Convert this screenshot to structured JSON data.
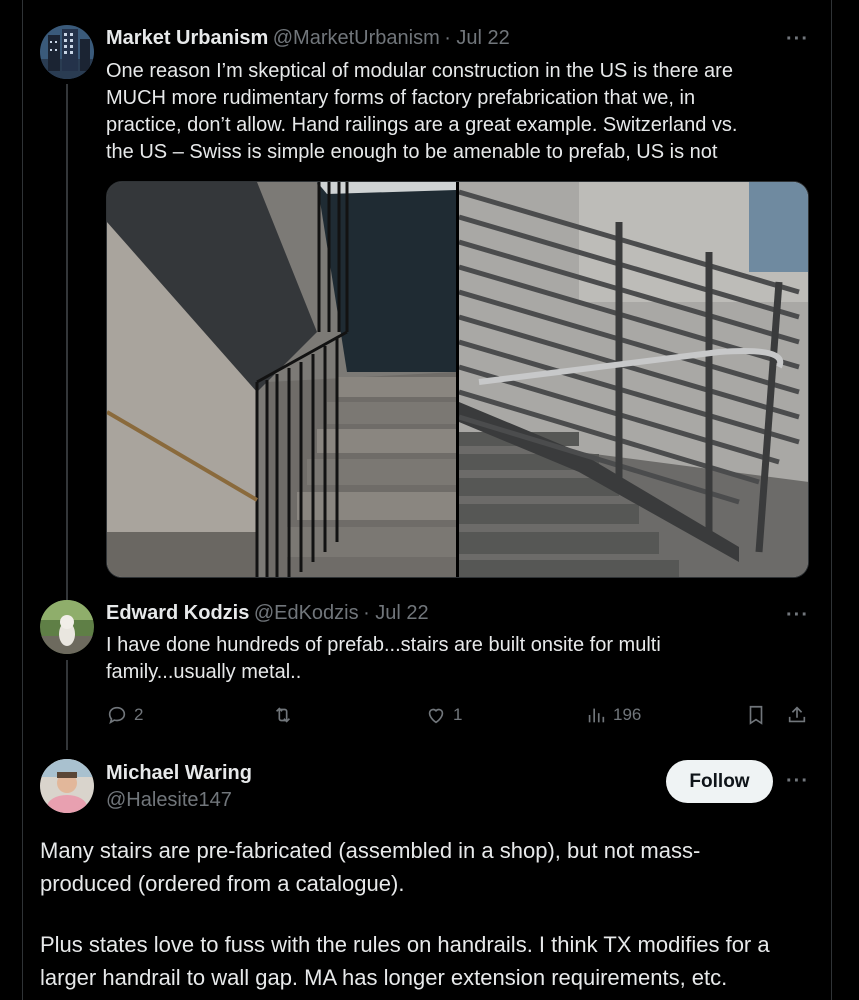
{
  "tweets": [
    {
      "name": "Market Urbanism",
      "handle": "@MarketUrbanism",
      "date": "· Jul 22",
      "text_lines": [
        "One reason I’m skeptical of modular construction in the US is there are",
        "MUCH more rudimentary forms of factory prefabrication that we, in",
        "practice, don’t allow. Hand railings are a great example. Switzerland vs.",
        "the US – Swiss is simple enough to be amenable to prefab, US is not"
      ],
      "media_description_icon": "photo-icon"
    },
    {
      "name": "Edward Kodzis",
      "handle": "@EdKodzis",
      "date": "· Jul 22",
      "text_lines": [
        "I have done hundreds of prefab...stairs are  built onsite for multi",
        "family...usually metal.."
      ],
      "actions": {
        "replies": "2",
        "retweets": "",
        "likes": "1",
        "views": "196"
      }
    },
    {
      "name": "Michael Waring",
      "handle": "@Halesite147",
      "follow_label": "Follow",
      "paragraph1_lines": [
        "Many stairs are pre-fabricated (assembled in a shop), but not mass-",
        "produced (ordered from a catalogue)."
      ],
      "paragraph2_lines": [
        "Plus states love to fuss with the rules on handrails. I think TX modifies for a",
        "larger handrail to wall gap. MA has longer extension requirements, etc."
      ]
    }
  ],
  "more_label": "···",
  "colors": {
    "background": "#000000",
    "text": "#e7e9ea",
    "secondary": "#71767b",
    "border": "#2f3336",
    "follow_bg": "#eff3f4"
  }
}
